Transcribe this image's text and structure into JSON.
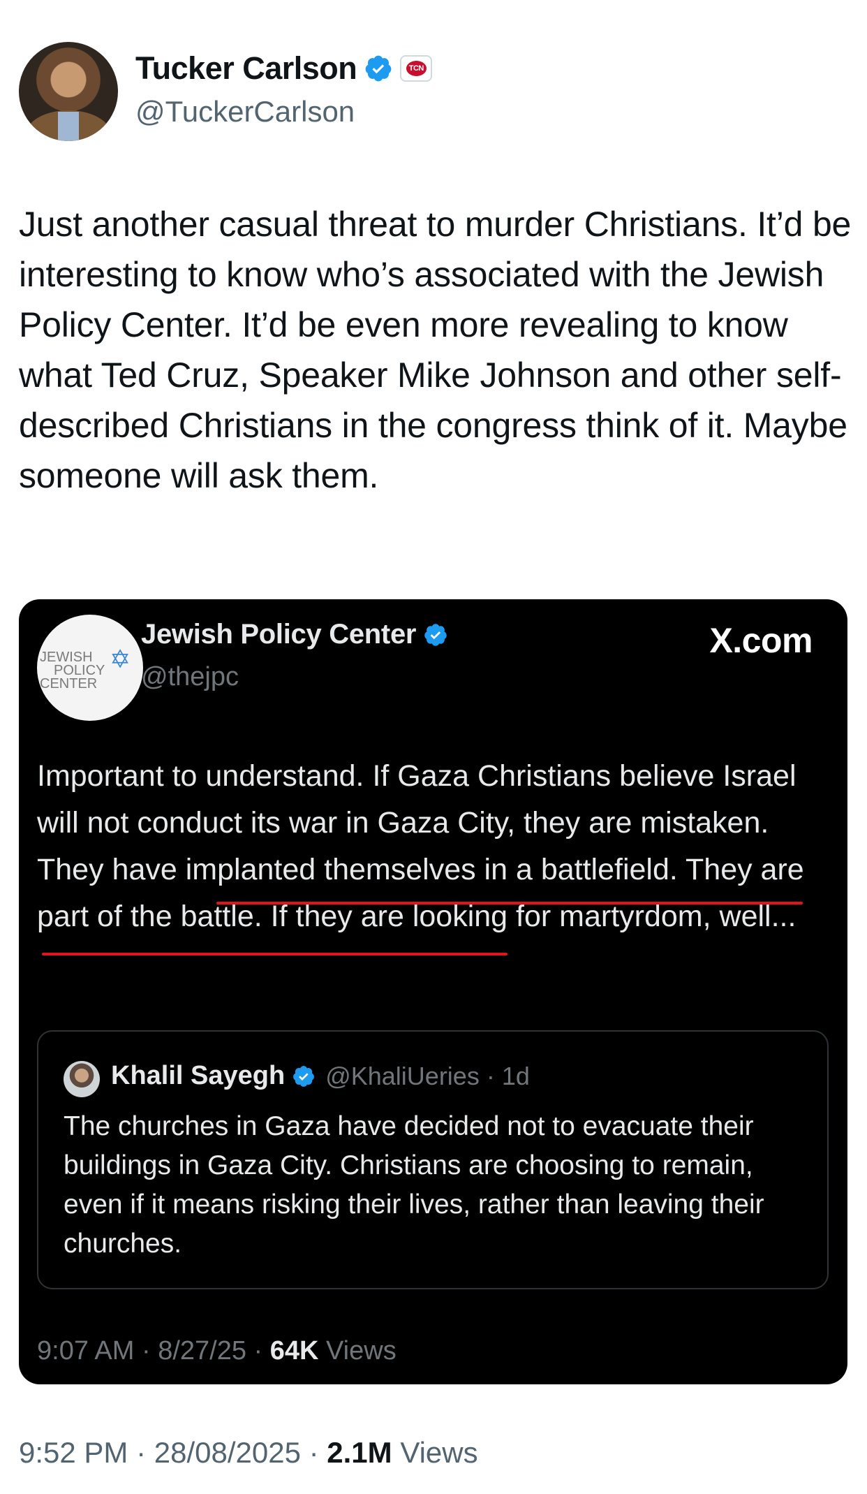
{
  "author": {
    "display_name": "Tucker Carlson",
    "handle": "@TuckerCarlson",
    "affiliation_badge": "TCN"
  },
  "tweet": {
    "text": "Just another casual threat to murder Christians. It’d be interesting to know who’s associated with the Jewish Policy Center. It’d be even more revealing to know what Ted Cruz, Speaker Mike Johnson and other self-described Christians in the congress think of it. Maybe someone will ask them."
  },
  "embedded": {
    "logo_lines": [
      "JEWISH",
      "POLICY",
      "CENTER"
    ],
    "display_name": "Jewish Policy Center",
    "handle": "@thejpc",
    "source_label": "X.com",
    "text": "Important to understand. If Gaza Christians believe Israel will not conduct its war in Gaza City, they are mistaken. They have implanted themselves in a battlefield. They are part of the battle. If they are looking for martyrdom, well...",
    "quote": {
      "display_name": "Khalil Sayegh",
      "handle": "@KhaliUeries · 1d",
      "text": "The churches in Gaza have decided not to evacuate their buildings in Gaza City. Christians are choosing to remain, even if it means risking their lives, rather than leaving their churches."
    },
    "meta": {
      "time": "9:07 AM · 8/27/25 · ",
      "views_count": "64K",
      "views_label": " Views"
    }
  },
  "meta": {
    "time": "9:52 PM · 28/08/2025 · ",
    "views_count": "2.1M",
    "views_label": " Views"
  },
  "colors": {
    "verified": "#1d9bf0",
    "underline": "#e0151c",
    "embed_bg": "#000000"
  }
}
